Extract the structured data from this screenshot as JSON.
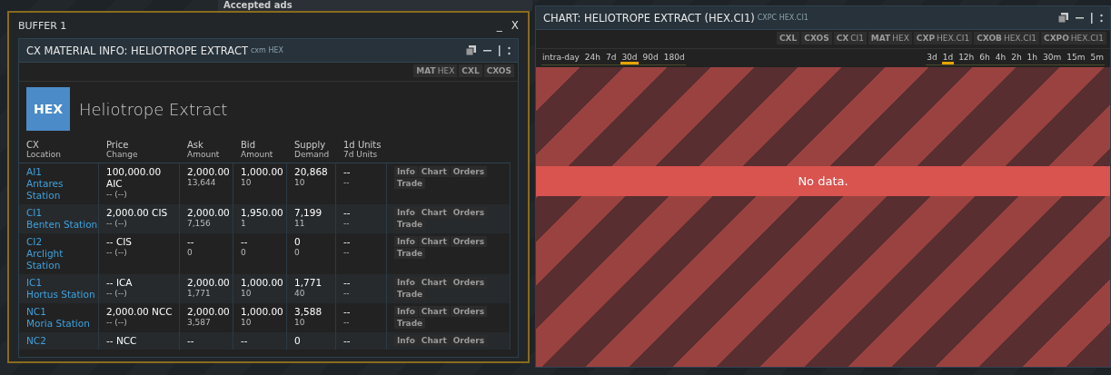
{
  "background": {
    "heading": "Accepted ads"
  },
  "buffer": {
    "title": "BUFFER 1",
    "minimize": "_",
    "close": "X",
    "panel": {
      "title": "CX MATERIAL INFO: HELIOTROPE EXTRACT",
      "command": "cxm HEX",
      "commands": [
        {
          "code": "MAT",
          "arg": "HEX"
        },
        {
          "code": "CXL"
        },
        {
          "code": "CXOS"
        }
      ],
      "ticker": "HEX",
      "material": "Heliotrope Extract",
      "columns": [
        {
          "label": "CX",
          "sub": "Location"
        },
        {
          "label": "Price",
          "sub": "Change"
        },
        {
          "label": "Ask",
          "sub": "Amount"
        },
        {
          "label": "Bid",
          "sub": "Amount"
        },
        {
          "label": "Supply",
          "sub": "Demand"
        },
        {
          "label": "1d Units",
          "sub": "7d Units"
        }
      ],
      "rows": [
        {
          "code": "AI1",
          "location": "Antares Station",
          "price": "100,000.00 AIC",
          "change": "-- (--)",
          "ask": "2,000.00",
          "ask_amount": "13,644",
          "bid": "1,000.00",
          "bid_amount": "10",
          "supply": "20,868",
          "demand": "10",
          "units_1d": "--",
          "units_7d": "--",
          "actions": [
            "Info",
            "Chart",
            "Orders",
            "Trade"
          ]
        },
        {
          "code": "CI1",
          "location": "Benten Station",
          "price": "2,000.00 CIS",
          "change": "-- (--)",
          "ask": "2,000.00",
          "ask_amount": "7,156",
          "bid": "1,950.00",
          "bid_amount": "1",
          "supply": "7,199",
          "demand": "11",
          "units_1d": "--",
          "units_7d": "--",
          "actions": [
            "Info",
            "Chart",
            "Orders",
            "Trade"
          ]
        },
        {
          "code": "CI2",
          "location": "Arclight Station",
          "price": "-- CIS",
          "change": "-- (--)",
          "ask": "--",
          "ask_amount": "0",
          "bid": "--",
          "bid_amount": "0",
          "supply": "0",
          "demand": "0",
          "units_1d": "--",
          "units_7d": "--",
          "actions": [
            "Info",
            "Chart",
            "Orders",
            "Trade"
          ]
        },
        {
          "code": "IC1",
          "location": "Hortus Station",
          "price": "-- ICA",
          "change": "-- (--)",
          "ask": "2,000.00",
          "ask_amount": "1,771",
          "bid": "1,000.00",
          "bid_amount": "10",
          "supply": "1,771",
          "demand": "40",
          "units_1d": "--",
          "units_7d": "--",
          "actions": [
            "Info",
            "Chart",
            "Orders",
            "Trade"
          ]
        },
        {
          "code": "NC1",
          "location": "Moria Station",
          "price": "2,000.00 NCC",
          "change": "-- (--)",
          "ask": "2,000.00",
          "ask_amount": "3,587",
          "bid": "1,000.00",
          "bid_amount": "10",
          "supply": "3,588",
          "demand": "10",
          "units_1d": "--",
          "units_7d": "--",
          "actions": [
            "Info",
            "Chart",
            "Orders",
            "Trade"
          ]
        },
        {
          "code": "NC2",
          "price": "-- NCC",
          "ask": "--",
          "bid": "--",
          "supply": "0",
          "units_1d": "--",
          "actions": [
            "Info",
            "Chart",
            "Orders"
          ]
        }
      ]
    }
  },
  "chart": {
    "title": "CHART: HELIOTROPE EXTRACT (HEX.CI1)",
    "command": "CXPC HEX.CI1",
    "commands": [
      {
        "code": "CXL"
      },
      {
        "code": "CXOS"
      },
      {
        "code": "CX",
        "arg": "CI1"
      },
      {
        "code": "MAT",
        "arg": "HEX"
      },
      {
        "code": "CXP",
        "arg": "HEX.CI1"
      },
      {
        "code": "CXOB",
        "arg": "HEX.CI1"
      },
      {
        "code": "CXPO",
        "arg": "HEX.CI1"
      }
    ],
    "ranges": [
      {
        "label": "intra-day",
        "selected": false
      },
      {
        "label": "24h",
        "selected": false
      },
      {
        "label": "7d",
        "selected": false
      },
      {
        "label": "30d",
        "selected": true
      },
      {
        "label": "90d",
        "selected": false
      },
      {
        "label": "180d",
        "selected": false
      }
    ],
    "intervals": [
      {
        "label": "3d",
        "selected": false
      },
      {
        "label": "1d",
        "selected": true
      },
      {
        "label": "12h",
        "selected": false
      },
      {
        "label": "6h",
        "selected": false
      },
      {
        "label": "4h",
        "selected": false
      },
      {
        "label": "2h",
        "selected": false
      },
      {
        "label": "1h",
        "selected": false
      },
      {
        "label": "30m",
        "selected": false
      },
      {
        "label": "15m",
        "selected": false
      },
      {
        "label": "5m",
        "selected": false
      }
    ],
    "message": "No data."
  }
}
